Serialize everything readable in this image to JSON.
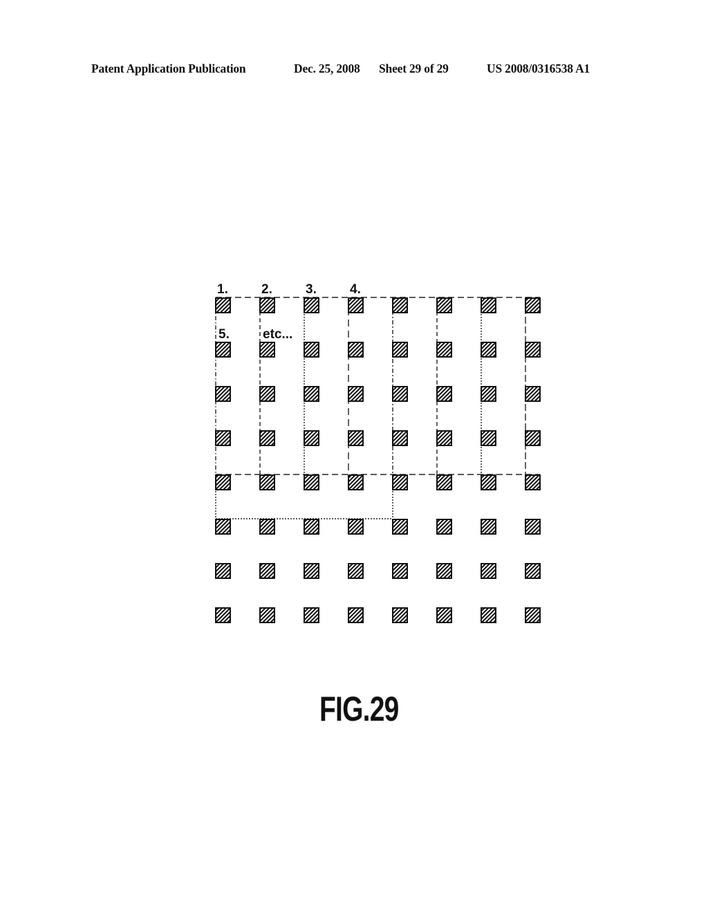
{
  "header": {
    "publication_type": "Patent Application Publication",
    "date": "Dec. 25, 2008",
    "sheet": "Sheet 29 of 29",
    "publication_number": "US 2008/0316538 A1"
  },
  "figure": {
    "caption": "FIG.29",
    "grid": {
      "rows": 8,
      "columns": 8,
      "cell_icon": "hatched-square"
    },
    "labels": {
      "label_1": "1.",
      "label_2": "2.",
      "label_3": "3.",
      "label_4": "4.",
      "label_5": "5.",
      "label_etc": "etc..."
    }
  }
}
